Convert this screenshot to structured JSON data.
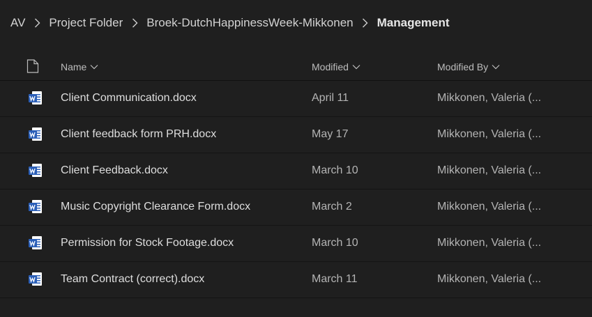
{
  "breadcrumb": {
    "items": [
      "AV",
      "Project Folder",
      "Broek-DutchHappinessWeek-Mikkonen"
    ],
    "current": "Management"
  },
  "columns": {
    "name": "Name",
    "modified": "Modified",
    "modified_by": "Modified By"
  },
  "files": [
    {
      "name": "Client Communication.docx",
      "modified": "April 11",
      "modified_by": "Mikkonen, Valeria (..."
    },
    {
      "name": "Client feedback form PRH.docx",
      "modified": "May 17",
      "modified_by": "Mikkonen, Valeria (..."
    },
    {
      "name": "Client Feedback.docx",
      "modified": "March 10",
      "modified_by": "Mikkonen, Valeria (..."
    },
    {
      "name": "Music Copyright Clearance Form.docx",
      "modified": "March 2",
      "modified_by": "Mikkonen, Valeria (..."
    },
    {
      "name": "Permission for Stock Footage.docx",
      "modified": "March 10",
      "modified_by": "Mikkonen, Valeria (..."
    },
    {
      "name": "Team Contract (correct).docx",
      "modified": "March 11",
      "modified_by": "Mikkonen, Valeria (..."
    }
  ],
  "icons": {
    "file_type_header": "document-icon",
    "file_row": "word-document-icon",
    "separator": "chevron-right-icon",
    "sort": "chevron-down-icon"
  },
  "colors": {
    "background": "#1f1f1f",
    "word_blue": "#2b5fb8",
    "text": "#dedede",
    "muted_text": "#b4b4b4"
  }
}
